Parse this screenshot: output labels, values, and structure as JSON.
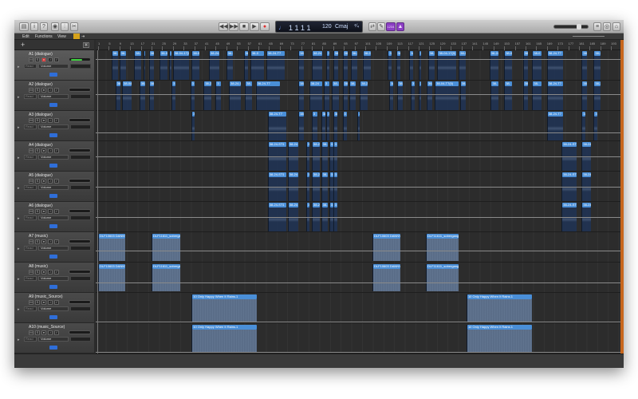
{
  "toolbar": {
    "left_icons": [
      "library-icon",
      "inspector-icon",
      "quick-help-icon",
      "smart-controls-icon",
      "mixer-icon",
      "editors-icon"
    ],
    "transport": [
      "rewind-icon",
      "fast-forward-icon",
      "stop-icon",
      "play-icon",
      "record-icon"
    ],
    "lcd": {
      "position": "1 1 1 1",
      "tempo": "120",
      "key": "Cmaj"
    },
    "count_in": "1234",
    "right_icons": [
      "list-editors-icon",
      "loop-browser-icon",
      "browser-icon"
    ],
    "master_volume": 0.75
  },
  "menubar": {
    "edit": "Edit",
    "functions": "Functions",
    "view": "View"
  },
  "ruler": [
    "1",
    "5",
    "9",
    "13",
    "17",
    "21",
    "25",
    "29",
    "33",
    "37",
    "41",
    "45",
    "49",
    "53",
    "57",
    "61",
    "65",
    "69",
    "73",
    "77",
    "81",
    "85",
    "89",
    "93",
    "97",
    "101",
    "105",
    "109",
    "113",
    "117",
    "121",
    "125",
    "129",
    "133",
    "137",
    "141",
    "145",
    "149",
    "153",
    "157",
    "161",
    "165",
    "169",
    "173",
    "177",
    "181",
    "185",
    "189",
    "193"
  ],
  "colors": {
    "region": "#4a8fd8",
    "accent": "#c7661d",
    "record": "#e03030",
    "purple": "#8c3fc4"
  },
  "tracks": [
    {
      "name": "A1 (dialogue)",
      "read": "Read",
      "param": "Volume",
      "meter": 0.6,
      "type": "dia",
      "auto": 0.3,
      "regions": [
        [
          6,
          8.5,
          "38-"
        ],
        [
          9,
          11.5,
          "38-"
        ],
        [
          14.5,
          17,
          "38-"
        ],
        [
          18,
          18.6,
          ""
        ],
        [
          20,
          22,
          "38-"
        ],
        [
          24,
          27,
          "38-04"
        ],
        [
          27.6,
          28.5,
          "3"
        ],
        [
          29,
          35,
          "38-04-17(0)"
        ],
        [
          36,
          39,
          "38-0"
        ],
        [
          42.5,
          46.5,
          "38-24-1"
        ],
        [
          49,
          51.5,
          "38-0"
        ],
        [
          55.5,
          57,
          "38-"
        ],
        [
          58,
          63,
          "38-0"
        ],
        [
          64,
          71,
          "38-24-T7"
        ],
        [
          76,
          78,
          "38-"
        ],
        [
          81,
          85,
          "38-24"
        ],
        [
          86.5,
          87.5,
          "3"
        ],
        [
          89,
          91,
          "38-"
        ],
        [
          92.5,
          94.5,
          "38-"
        ],
        [
          95.5,
          98,
          "38-24-07"
        ],
        [
          100,
          103,
          "38-24"
        ],
        [
          109.5,
          111,
          "38-"
        ],
        [
          112.5,
          114,
          "38-"
        ],
        [
          117.5,
          119,
          "38-"
        ],
        [
          121,
          122,
          "3"
        ],
        [
          124.5,
          127,
          "38-"
        ],
        [
          128,
          135,
          "38-04-17(0)"
        ],
        [
          136,
          138.5,
          "38-0"
        ],
        [
          147.5,
          151,
          "38-24-1"
        ],
        [
          153,
          156,
          "38-0"
        ],
        [
          160,
          162,
          "38-"
        ],
        [
          163.5,
          167,
          "38-0"
        ],
        [
          169,
          175,
          "38-24-T7"
        ],
        [
          182,
          184,
          "38-"
        ],
        [
          186.5,
          189,
          "38-24"
        ]
      ]
    },
    {
      "name": "A2 (dialogue)",
      "read": "Read",
      "param": "Volume",
      "meter": 0,
      "type": "dia",
      "auto": 0.45,
      "regions": [
        [
          7.5,
          9.5,
          "38-"
        ],
        [
          10,
          13.5,
          "38-04"
        ],
        [
          16.5,
          18.5,
          "38-"
        ],
        [
          20,
          22,
          "38-"
        ],
        [
          28.5,
          30,
          "3"
        ],
        [
          35.5,
          37,
          "3"
        ],
        [
          40.5,
          43.5,
          "38-24-0"
        ],
        [
          45,
          47,
          "3"
        ],
        [
          50,
          54.5,
          "38-24-0"
        ],
        [
          56,
          58.5,
          "38-"
        ],
        [
          60,
          69,
          "38-24-T7"
        ],
        [
          76,
          78,
          "38-"
        ],
        [
          80,
          85,
          "38-24"
        ],
        [
          85.5,
          87.5,
          "3"
        ],
        [
          88.5,
          91,
          "38-"
        ],
        [
          92.5,
          94.5,
          "38-"
        ],
        [
          95,
          97.5,
          "38-"
        ],
        [
          99,
          102,
          "38-24"
        ],
        [
          110,
          111.5,
          "38-"
        ],
        [
          113,
          115,
          "38-"
        ],
        [
          118,
          119.5,
          "3"
        ],
        [
          121,
          122,
          "3"
        ],
        [
          124,
          126,
          "38-"
        ],
        [
          127,
          136,
          "38-04-T7(0)"
        ],
        [
          136.5,
          138.5,
          "38-"
        ],
        [
          148,
          151,
          "38-"
        ],
        [
          153,
          156,
          "38-"
        ],
        [
          160,
          162,
          "38-"
        ],
        [
          163.5,
          167,
          "38-"
        ],
        [
          169,
          175,
          "38-24-T7"
        ],
        [
          182,
          184,
          "38-"
        ],
        [
          186.5,
          189,
          "38-24"
        ]
      ]
    },
    {
      "name": "A3 (dialogue)",
      "read": "Read",
      "param": "Volume",
      "meter": 0,
      "type": "dia",
      "auto": 0.7,
      "regions": [
        [
          36,
          37.2,
          "3"
        ],
        [
          64.5,
          71.5,
          "38-24-T7"
        ],
        [
          76,
          78,
          "38-"
        ],
        [
          81,
          83,
          "3"
        ],
        [
          84.5,
          86,
          "38-"
        ],
        [
          86.5,
          87.5,
          "3"
        ],
        [
          89,
          90.5,
          "38-"
        ],
        [
          92.5,
          94,
          "3"
        ],
        [
          98,
          99,
          "3"
        ],
        [
          169,
          175,
          "38-24-T7"
        ],
        [
          182,
          183.5,
          "38-"
        ],
        [
          186.5,
          188,
          "3"
        ]
      ]
    },
    {
      "name": "A4 (dialogue)",
      "read": "Read",
      "param": "Volume",
      "meter": 0,
      "type": "dia",
      "auto": 0.5,
      "regions": [
        [
          64.5,
          71.5,
          "38-24-ST1"
        ],
        [
          72,
          76,
          "38-24"
        ],
        [
          79,
          80,
          "3"
        ],
        [
          81,
          84,
          "38-24"
        ],
        [
          84.5,
          87,
          "38-"
        ],
        [
          87.5,
          89,
          "3"
        ],
        [
          89,
          90.5,
          "3"
        ],
        [
          174.5,
          180,
          "38-24-ST1"
        ],
        [
          182,
          185.5,
          "38-24"
        ]
      ]
    },
    {
      "name": "A5 (dialogue)",
      "read": "Read",
      "param": "Volume",
      "meter": 0,
      "type": "dia",
      "auto": 0.5,
      "regions": [
        [
          64.5,
          71.5,
          "38-24-ST1"
        ],
        [
          72,
          76,
          "38-24"
        ],
        [
          79,
          80,
          "3"
        ],
        [
          81,
          84,
          "38-24"
        ],
        [
          84.5,
          87,
          "38-"
        ],
        [
          87.5,
          89,
          "3"
        ],
        [
          89,
          90.5,
          "3"
        ],
        [
          174.5,
          180,
          "38-24-ST1"
        ],
        [
          182,
          185.5,
          "38-24"
        ]
      ]
    },
    {
      "name": "A6 (dialogue)",
      "read": "Read",
      "param": "Volume",
      "meter": 0,
      "type": "dia",
      "auto": 0.5,
      "regions": [
        [
          64.5,
          71.5,
          "38-24-ST1"
        ],
        [
          72,
          76,
          "38-24"
        ],
        [
          79,
          80,
          "3"
        ],
        [
          81,
          84,
          "38-24"
        ],
        [
          84.5,
          87,
          "38-"
        ],
        [
          87.5,
          89,
          "3"
        ],
        [
          89,
          90.5,
          "3"
        ],
        [
          174.5,
          180,
          "38-24-ST1"
        ],
        [
          182,
          185.5,
          "38-24"
        ]
      ]
    },
    {
      "name": "A7 (music)",
      "read": "Read",
      "param": "Volume",
      "meter": 0,
      "type": "mus",
      "auto": 0.6,
      "regions": [
        [
          1,
          11,
          "DLF10603 DANNY 1"
        ],
        [
          21,
          31.7,
          "DLF11611_sobergang"
        ],
        [
          103.7,
          114,
          "DLF10603 DANNY"
        ],
        [
          123.7,
          136,
          "DLF11611_sobergang"
        ]
      ]
    },
    {
      "name": "A8 (music)",
      "read": "Read",
      "param": "Volume",
      "meter": 0,
      "type": "mus",
      "auto": 0.65,
      "regions": [
        [
          1,
          11,
          "DLF10603 DANNY 1"
        ],
        [
          21,
          31.7,
          "DLF11611_sobergang"
        ],
        [
          103.7,
          114,
          "DLF10603 DANNY"
        ],
        [
          123.7,
          136,
          "DLF11611_sobergang"
        ]
      ]
    },
    {
      "name": "A9 (music_Source)",
      "read": "Read",
      "param": "Volume",
      "meter": 0,
      "type": "mus",
      "auto": 0.95,
      "regions": [
        [
          36,
          60.4,
          "10 Only Happy When It Rains.1"
        ],
        [
          138.9,
          163.4,
          "10 Only Happy When It Rains.1"
        ]
      ]
    },
    {
      "name": "A10 (music_Source)",
      "read": "Read",
      "param": "Volume",
      "meter": 0,
      "type": "mus",
      "auto": 0.95,
      "regions": [
        [
          36,
          60.4,
          "10 Only Happy When It Rains.1"
        ],
        [
          138.9,
          163.4,
          "10 Only Happy When It Rains.1"
        ]
      ]
    }
  ]
}
